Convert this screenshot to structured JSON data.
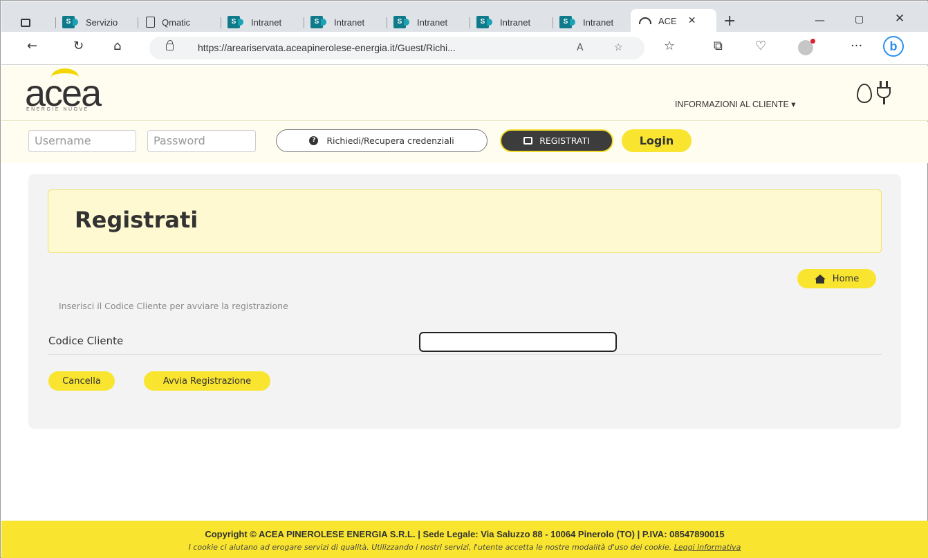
{
  "browser": {
    "tabs": [
      {
        "label": "Servizio",
        "icon": "sharepoint-icon"
      },
      {
        "label": "Qmatic",
        "icon": "document-icon"
      },
      {
        "label": "Intranet",
        "icon": "sharepoint-icon"
      },
      {
        "label": "Intranet",
        "icon": "sharepoint-icon"
      },
      {
        "label": "Intranet",
        "icon": "sharepoint-icon"
      },
      {
        "label": "Intranet",
        "icon": "sharepoint-icon"
      },
      {
        "label": "Intranet",
        "icon": "sharepoint-icon"
      }
    ],
    "active_tab": {
      "label": "ACE",
      "icon": "acea-icon"
    },
    "url": "https://areariservata.aceapinerolese-energia.it/Guest/Richi..."
  },
  "site": {
    "logo_text": "acea",
    "logo_subtitle": "ENERGIE NUOVE",
    "menu_info": "INFORMAZIONI AL CLIENTE ▾"
  },
  "login": {
    "username_placeholder": "Username",
    "password_placeholder": "Password",
    "recover_label": "Richiedi/Recupera credenziali",
    "register_label": "REGISTRATI",
    "login_label": "Login"
  },
  "page": {
    "title": "Registrati",
    "home_label": "Home",
    "intro": "Inserisci il Codice Cliente per avviare la registrazione",
    "field_label": "Codice Cliente",
    "field_value": "",
    "cancel_label": "Cancella",
    "start_label": "Avvia Registrazione"
  },
  "footer": {
    "copyright": "Copyright © ACEA PINEROLESE ENERGIA S.R.L.  | Sede Legale: Via Saluzzo 88 - 10064 Pinerolo (TO) | P.IVA: 08547890015",
    "cookie_text": "I cookie ci aiutano ad erogare servizi di qualità. Utilizzando i nostri servizi, l'utente accetta le nostre modalità d'uso dei cookie. ",
    "cookie_link": "Leggi informativa"
  },
  "colors": {
    "brand_yellow": "#f9e52f",
    "header_bg": "#fffdf0",
    "title_box_bg": "#fff9d2",
    "dark_button": "#3c3c3c"
  }
}
